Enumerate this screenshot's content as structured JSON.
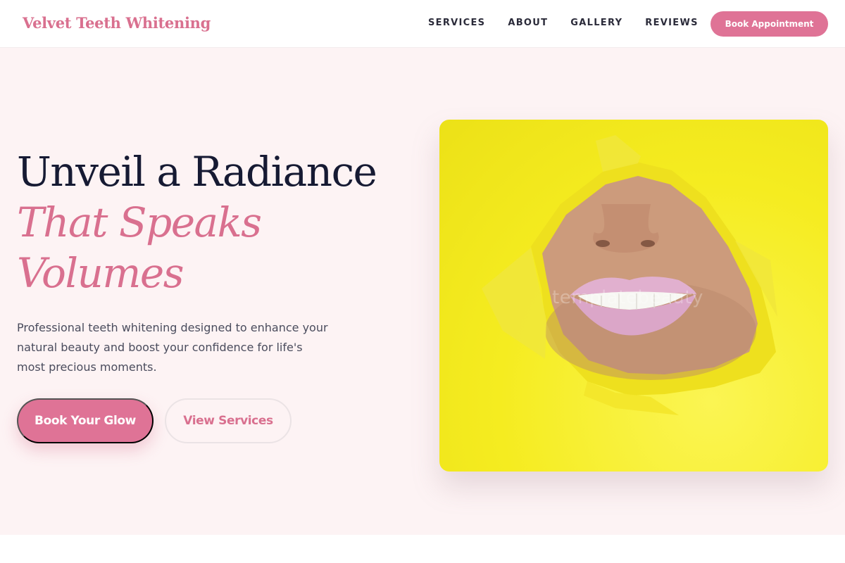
{
  "brand": {
    "name": "Velvet Teeth Whitening"
  },
  "nav": {
    "links": [
      {
        "label": "SERVICES"
      },
      {
        "label": "ABOUT"
      },
      {
        "label": "GALLERY"
      },
      {
        "label": "REVIEWS"
      }
    ],
    "cta_label": "Book Appointment"
  },
  "hero": {
    "headline_line1": "Unveil a Radiance",
    "headline_accent_line1": "That Speaks",
    "headline_accent_line2": "Volumes",
    "lead": "Professional teeth whitening designed to enhance your natural beauty and boost your confidence for life's most precious moments.",
    "primary_button": "Book Your Glow",
    "secondary_button": "View Services",
    "image_watermark": "templatebeauty"
  },
  "colors": {
    "accent": "#df7396",
    "accent_text": "#d9708f",
    "hero_background": "#fdf3f4",
    "heading": "#161a33",
    "image_background": "#f5ec20"
  }
}
